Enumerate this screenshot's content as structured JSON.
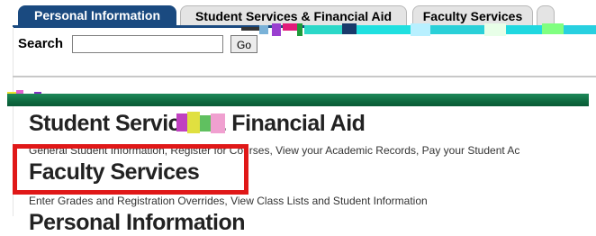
{
  "tabs": [
    {
      "label": "Personal Information",
      "active": true
    },
    {
      "label": "Student Services & Financial Aid",
      "active": false
    },
    {
      "label": "Faculty Services",
      "active": false
    },
    {
      "label": "",
      "active": false
    }
  ],
  "search": {
    "label": "Search",
    "value": "",
    "button_label": "Go"
  },
  "sections": [
    {
      "title": "Student Services & Financial Aid",
      "description": "General Student Information, Register for Courses, View your Academic Records, Pay your Student Ac"
    },
    {
      "title": "Faculty Services",
      "description": "Enter Grades and Registration Overrides, View Class Lists and Student Information"
    },
    {
      "title": "Personal Information"
    }
  ],
  "colors": {
    "tab_active": "#1a4a80",
    "highlight_border": "#e01818",
    "banner_green": "#0e6a40"
  }
}
